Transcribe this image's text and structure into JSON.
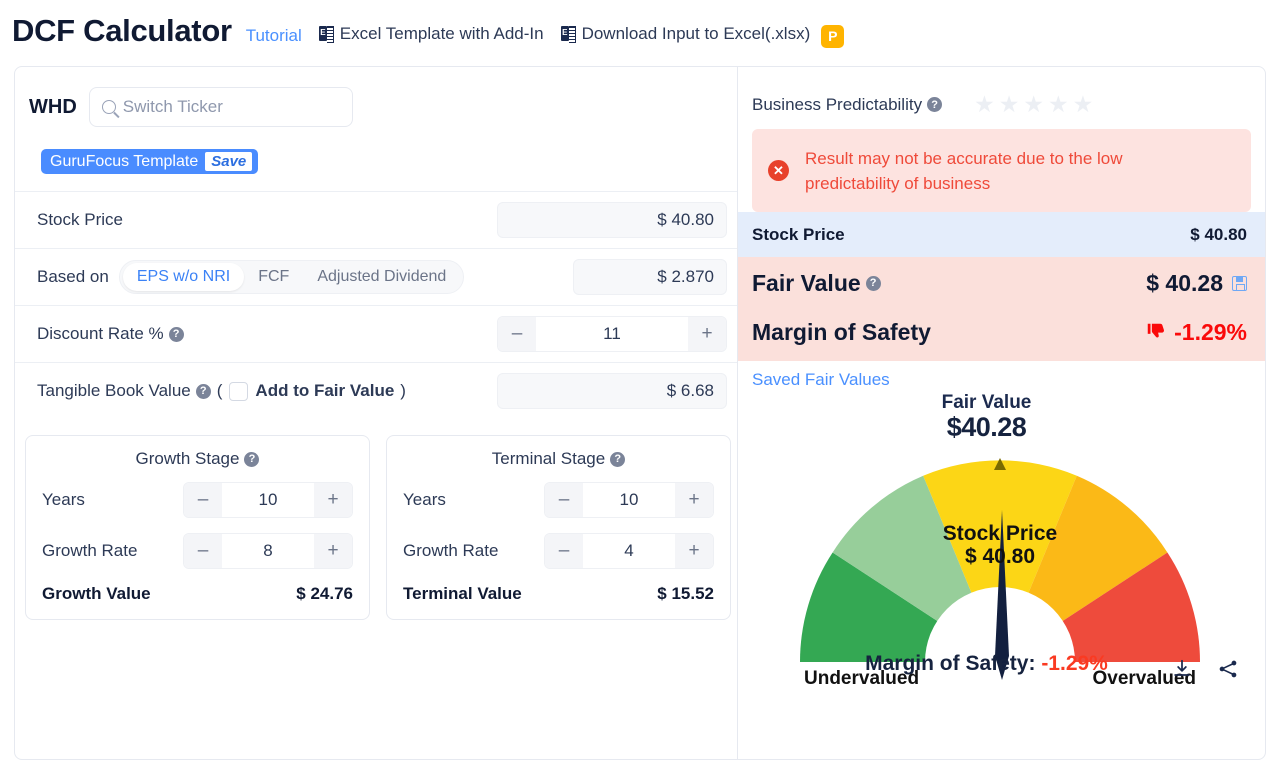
{
  "header": {
    "title": "DCF Calculator",
    "tutorial_label": "Tutorial",
    "excel_template_label": "Excel Template with Add-In",
    "download_input_label": "Download Input to Excel(.xlsx)",
    "premium_badge": "P",
    "excel_icon_letter": "E"
  },
  "left": {
    "ticker": "WHD",
    "search_placeholder": "Switch Ticker",
    "template_name": "GuruFocus Template",
    "template_save_label": "Save",
    "stock_price_label": "Stock Price",
    "stock_price_value": "$ 40.80",
    "based_on_label": "Based on",
    "based_on_options": [
      "EPS w/o NRI",
      "FCF",
      "Adjusted Dividend"
    ],
    "based_on_selected": "EPS w/o NRI",
    "based_on_value": "$ 2.870",
    "discount_rate_label": "Discount Rate %",
    "discount_rate_value": "11",
    "tangible_book_label": "Tangible Book Value",
    "tangible_open_paren": "(",
    "add_to_fair_value_label": "Add to Fair Value",
    "tangible_close_paren": ")",
    "tangible_book_value": "$ 6.68",
    "stepper_minus": "–",
    "stepper_plus": "+",
    "help_glyph": "?",
    "growth_stage": {
      "title": "Growth Stage",
      "years_label": "Years",
      "years_value": "10",
      "growth_rate_label": "Growth Rate",
      "growth_rate_value": "8",
      "value_label": "Growth Value",
      "value_amount": "$ 24.76"
    },
    "terminal_stage": {
      "title": "Terminal Stage",
      "years_label": "Years",
      "years_value": "10",
      "growth_rate_label": "Growth Rate",
      "growth_rate_value": "4",
      "value_label": "Terminal Value",
      "value_amount": "$ 15.52"
    }
  },
  "right": {
    "predictability_label": "Business Predictability",
    "predictability_stars_filled": 0,
    "predictability_stars_total": 5,
    "star_glyph": "★",
    "alert_icon": "✕",
    "alert_text": "Result may not be accurate due to the low predictability of business",
    "stock_price_label": "Stock Price",
    "stock_price_value": "$ 40.80",
    "fair_value_label": "Fair Value",
    "fair_value_amount": "$ 40.28",
    "margin_label": "Margin of Safety",
    "margin_value": "-1.29%",
    "saved_fair_values_label": "Saved Fair Values"
  },
  "gauge": {
    "fair_value_label": "Fair Value",
    "fair_value_amount": "$40.28",
    "stock_price_label": "Stock Price",
    "stock_price_amount": "$ 40.80",
    "left_label": "Undervalued",
    "right_label": "Overvalued",
    "caption_prefix": "Margin of Safety: ",
    "caption_value": "-1.29%",
    "segment_colors": [
      "#34a853",
      "#97ce9a",
      "#fcd616",
      "#fbb917",
      "#ee4b3c"
    ]
  }
}
